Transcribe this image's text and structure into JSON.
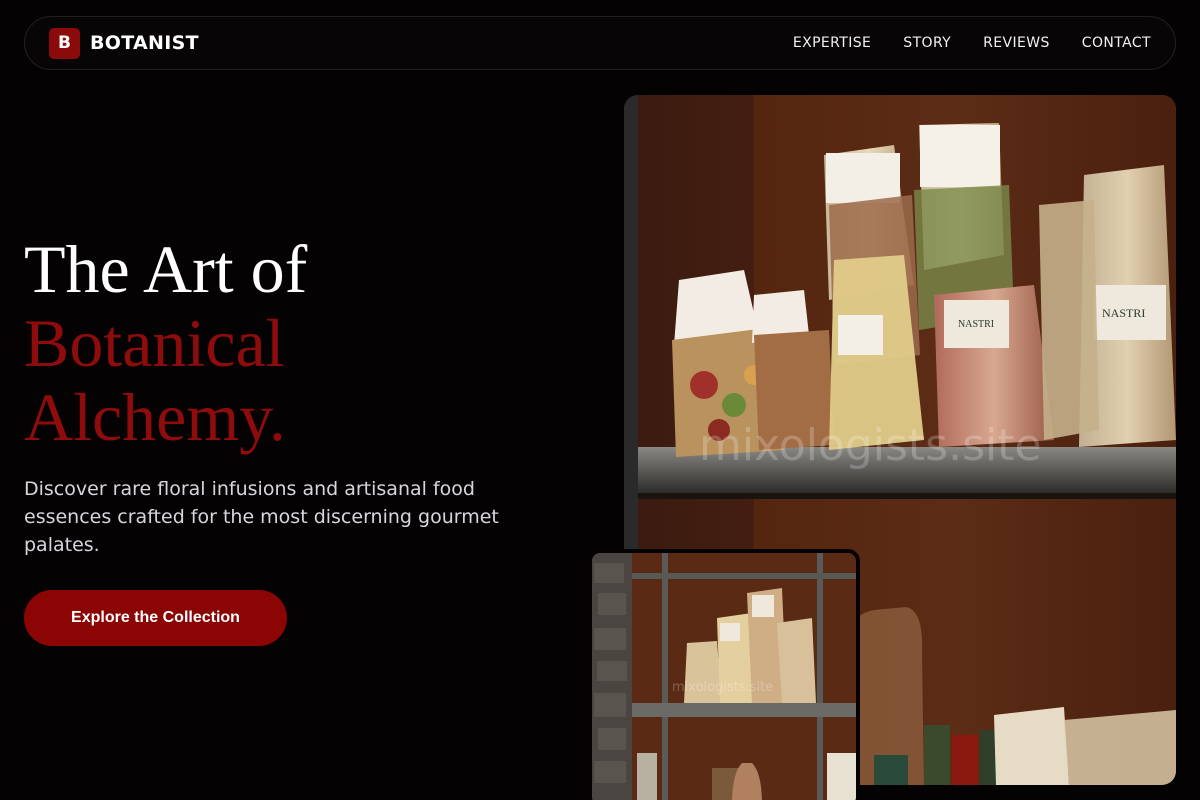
{
  "brand": {
    "mark": "B",
    "name": "BOTANIST"
  },
  "nav": {
    "items": [
      {
        "label": "EXPERTISE"
      },
      {
        "label": "STORY"
      },
      {
        "label": "REVIEWS"
      },
      {
        "label": "CONTACT"
      }
    ]
  },
  "hero": {
    "title_line1": "The Art of",
    "title_line2": "Botanical",
    "title_line3": "Alchemy.",
    "description": "Discover rare floral infusions and artisanal food essences crafted for the most discerning gourmet palates.",
    "cta_label": "Explore the Collection"
  },
  "images": {
    "main_watermark": "mixologists.site",
    "small_watermark": "mixologists.site",
    "main_bag_labels": [
      "NASTRI",
      "NASTRI"
    ]
  },
  "colors": {
    "accent": "#8b0505",
    "background": "#050203",
    "title_red": "#8e0c0c"
  }
}
